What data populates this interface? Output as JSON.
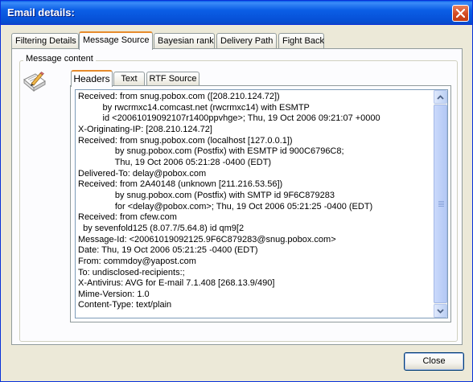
{
  "window": {
    "title": "Email details:"
  },
  "tabs": [
    {
      "label": "Filtering Details"
    },
    {
      "label": "Message Source",
      "active": true
    },
    {
      "label": "Bayesian rank"
    },
    {
      "label": "Delivery Path"
    },
    {
      "label": "Fight Back"
    }
  ],
  "group": {
    "legend": "Message content"
  },
  "subtabs": [
    {
      "label": "Headers",
      "active": true
    },
    {
      "label": "Text"
    },
    {
      "label": "RTF Source"
    }
  ],
  "headers_text": "Received: from snug.pobox.com ([208.210.124.72])\n          by rwcrmxc14.comcast.net (rwcrmxc14) with ESMTP\n          id <20061019092107r1400ppvhge>; Thu, 19 Oct 2006 09:21:07 +0000\nX-Originating-IP: [208.210.124.72]\nReceived: from snug.pobox.com (localhost [127.0.0.1])\n               by snug.pobox.com (Postfix) with ESMTP id 900C6796C8;\n               Thu, 19 Oct 2006 05:21:28 -0400 (EDT)\nDelivered-To: delay@pobox.com\nReceived: from 2A40148 (unknown [211.216.53.56])\n               by snug.pobox.com (Postfix) with SMTP id 9F6C879283\n               for <delay@pobox.com>; Thu, 19 Oct 2006 05:21:25 -0400 (EDT)\nReceived: from cfew.com\n  by sevenfold125 (8.07.7/5.64.8) id qm9[2\nMessage-Id: <20061019092125.9F6C879283@snug.pobox.com>\nDate: Thu, 19 Oct 2006 05:21:25 -0400 (EDT)\nFrom: commdoy@yapost.com\nTo: undisclosed-recipients:;\nX-Antivirus: AVG for E-mail 7.1.408 [268.13.9/490]\nMime-Version: 1.0\nContent-Type: text/plain",
  "buttons": {
    "close": "Close"
  },
  "colors": {
    "titlebar": "#0a5fe8",
    "active_tab_accent": "#e68b2c",
    "face": "#ece9d8"
  },
  "icons": {
    "title_close": "close-icon",
    "message": "document-pencil-icon"
  }
}
